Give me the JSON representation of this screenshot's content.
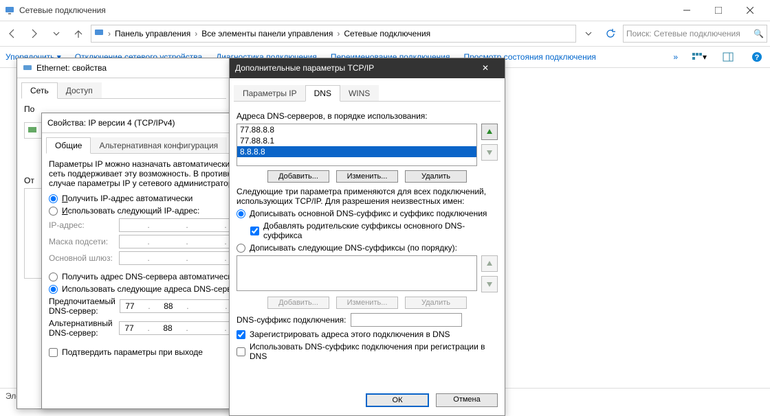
{
  "explorer": {
    "title": "Сетевые подключения",
    "breadcrumbs": [
      "Панель управления",
      "Все элементы панели управления",
      "Сетевые подключения"
    ],
    "searchPlaceholder": "Поиск: Сетевые подключения",
    "toolbar": {
      "organize": "Упорядочить",
      "disable": "Отключение сетевого устройства",
      "diagnose": "Диагностика подключения",
      "rename": "Переименование подключения",
      "status": "Просмотр состояния подключения"
    },
    "statusbar": "Элемент"
  },
  "ethDialog": {
    "title": "Ethernet: свойства",
    "tabs": {
      "net": "Сеть",
      "access": "Доступ"
    },
    "connectLabelPartial": "По",
    "disableLabelPartial": "От"
  },
  "ipv4Dialog": {
    "title": "Свойства: IP версии 4 (TCP/IPv4)",
    "tabs": {
      "general": "Общие",
      "alt": "Альтернативная конфигурация"
    },
    "desc": "Параметры IP можно назначать автоматически, если сеть поддерживает эту возможность. В противном случае параметры IP у сетевого администратора.",
    "rAutoIP": "Получить IP-адрес автоматически",
    "rManualIP": "Использовать следующий IP-адрес:",
    "labels": {
      "ip": "IP-адрес:",
      "mask": "Маска подсети:",
      "gateway": "Основной шлюз:"
    },
    "rAutoDNS": "Получить адрес DNS-сервера автоматически",
    "rManualDNS": "Использовать следующие адреса DNS-серверов:",
    "dnsLabels": {
      "pref": "Предпочитаемый DNS-сервер:",
      "alt": "Альтернативный DNS-сервер:"
    },
    "dns1": [
      "77",
      "88",
      "",
      " "
    ],
    "dns2": [
      "77",
      "88",
      "",
      " "
    ],
    "chkValidate": "Подтвердить параметры при выходе"
  },
  "advDialog": {
    "title": "Дополнительные параметры TCP/IP",
    "tabs": {
      "ip": "Параметры IP",
      "dns": "DNS",
      "wins": "WINS"
    },
    "dnsListLabel": "Адреса DNS-серверов, в порядке использования:",
    "dnsList": [
      "77.88.8.8",
      "77.88.8.1",
      "8.8.8.8"
    ],
    "dnsSelectedIndex": 2,
    "btns": {
      "add": "Добавить...",
      "edit": "Изменить...",
      "del": "Удалить"
    },
    "para": "Следующие три параметра применяются для всех подключений, использующих TCP/IP. Для разрешения неизвестных имен:",
    "rSuffix1": "Дописывать основной DNS-суффикс и суффикс подключения",
    "chkParent": "Добавлять родительские суффиксы основного DNS-суффикса",
    "rSuffix2": "Дописывать следующие DNS-суффиксы (по порядку):",
    "suffixLabel": "DNS-суффикс подключения:",
    "chkRegister": "Зарегистрировать адреса этого подключения в DNS",
    "chkUseSuffix": "Использовать DNS-суффикс подключения при регистрации в DNS",
    "ok": "ОК",
    "cancel": "Отмена"
  }
}
